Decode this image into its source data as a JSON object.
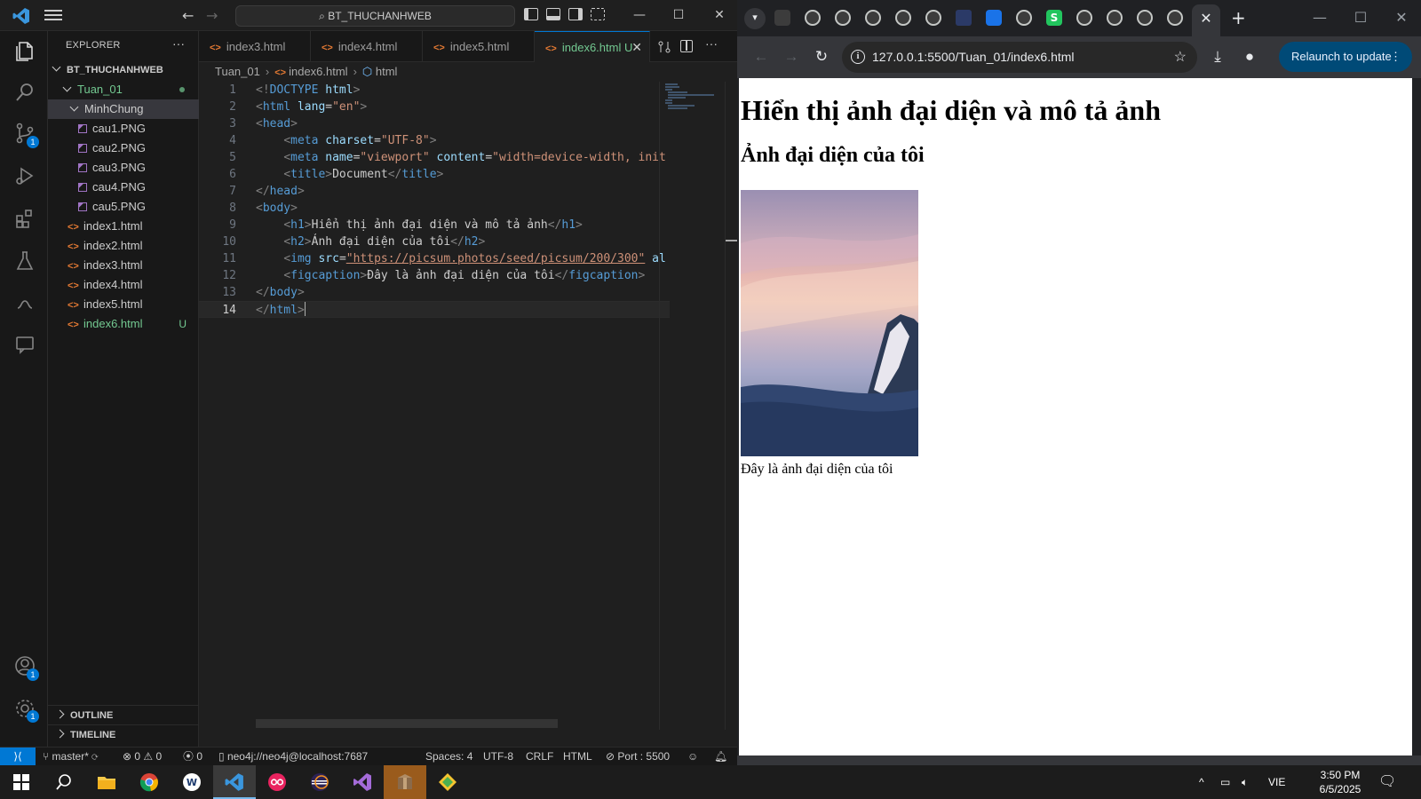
{
  "vscode": {
    "search_text": "BT_THUCHANHWEB",
    "explorer": {
      "title": "EXPLORER",
      "root": "BT_THUCHANHWEB",
      "folder": "Tuan_01",
      "subfolder": "MinhChung",
      "images": [
        "cau1.PNG",
        "cau2.PNG",
        "cau3.PNG",
        "cau4.PNG",
        "cau5.PNG"
      ],
      "html_files": [
        "index1.html",
        "index2.html",
        "index3.html",
        "index4.html",
        "index5.html"
      ],
      "new_file": "index6.html",
      "new_file_status": "U",
      "outline": "OUTLINE",
      "timeline": "TIMELINE"
    },
    "tabs": [
      {
        "label": "index3.html"
      },
      {
        "label": "index4.html"
      },
      {
        "label": "index5.html"
      },
      {
        "label": "index6.html",
        "status": "U",
        "active": true
      }
    ],
    "breadcrumb": {
      "folder": "Tuan_01",
      "file": "index6.html",
      "symbol": "html"
    },
    "badges": {
      "source_control": "1",
      "accounts": "1",
      "settings": "1"
    },
    "code_line_numbers": [
      "1",
      "2",
      "3",
      "4",
      "5",
      "6",
      "7",
      "8",
      "9",
      "10",
      "11",
      "12",
      "13",
      "14"
    ],
    "code": {
      "l1": "<!DOCTYPE html>",
      "l2_lang": "\"en\"",
      "l4_charset": "\"UTF-8\"",
      "l5_name": "\"viewport\"",
      "l5_content": "\"width=device-width, init",
      "l6_title": "Document",
      "l9_text": "Hiển thị ảnh đại diện và mô tả ảnh",
      "l10_text": "Ảnh đại diện của tôi",
      "l11_src": "\"https://picsum.photos/seed/picsum/200/300\"",
      "l11_tail": " al",
      "l12_text": "Đây là ảnh đại diện của tôi"
    },
    "status": {
      "branch": "master*",
      "errors": "0",
      "warnings": "0",
      "ports": "0",
      "db": "neo4j://neo4j@localhost:7687",
      "spaces": "Spaces: 4",
      "encoding": "UTF-8",
      "eol": "CRLF",
      "language": "HTML",
      "port": "Port : 5500"
    }
  },
  "browser": {
    "url": "127.0.0.1:5500/Tuan_01/index6.html",
    "relaunch_label": "Relaunch to update",
    "page": {
      "h1": "Hiển thị ảnh đại diện và mô tả ảnh",
      "h2": "Ảnh đại diện của tôi",
      "caption": "Đây là ảnh đại diện của tôi"
    }
  },
  "taskbar": {
    "lang": "VIE",
    "time": "3:50 PM",
    "date": "6/5/2025"
  },
  "colors": {
    "vscode_bg": "#1f1f1f",
    "accent": "#0078d4",
    "git_untracked": "#73c991",
    "html_icon": "#e37933"
  }
}
